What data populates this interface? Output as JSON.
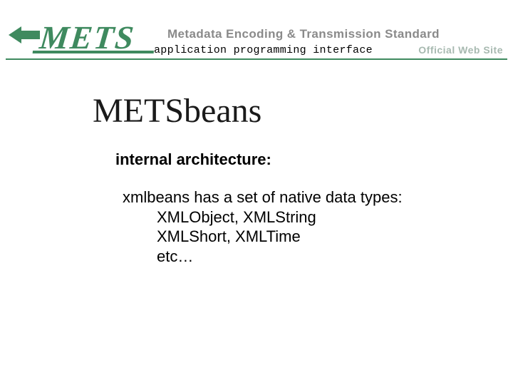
{
  "header": {
    "logo": "METS",
    "subtitle": "Metadata Encoding & Transmission Standard",
    "api_label": "application programming interface",
    "official": "Official Web Site"
  },
  "content": {
    "title": "METSbeans",
    "subtitle": "internal architecture:",
    "line1": "xmlbeans has a set of native data types:",
    "line2": "XMLObject, XMLString",
    "line3": "XMLShort, XMLTime",
    "line4": "etc…"
  }
}
